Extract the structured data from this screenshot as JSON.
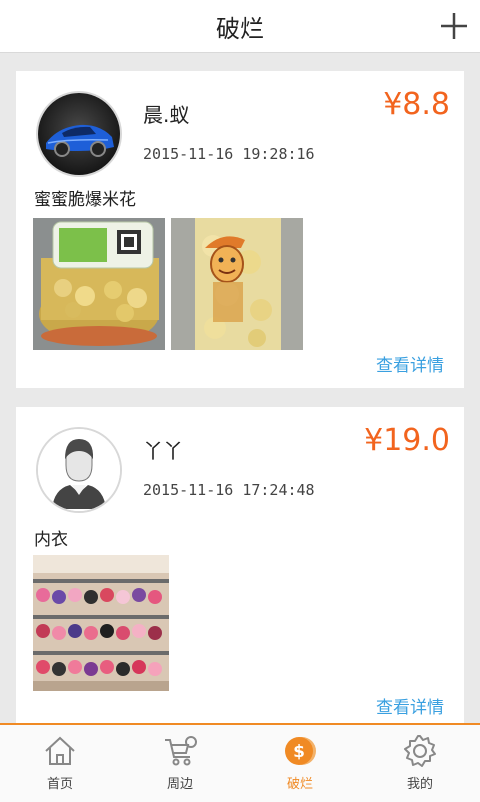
{
  "header": {
    "title": "破烂",
    "add_icon": "plus-icon"
  },
  "posts": [
    {
      "username": "晨.蚁",
      "datetime": "2015-11-16 19:28:16",
      "price": "¥8.8",
      "title": "蜜蜜脆爆米花",
      "detail_link": "查看详情"
    },
    {
      "username": "丫丫",
      "datetime": "2015-11-16 17:24:48",
      "price": "¥19.0",
      "title": "内衣",
      "detail_link": "查看详情"
    }
  ],
  "tabbar": {
    "items": [
      {
        "label": "首页",
        "icon": "home-icon"
      },
      {
        "label": "周边",
        "icon": "cart-icon"
      },
      {
        "label": "破烂",
        "icon": "coin-icon",
        "active": true
      },
      {
        "label": "我的",
        "icon": "gear-icon"
      }
    ]
  },
  "colors": {
    "accent": "#f08a24",
    "price": "#f2641e",
    "link": "#3aa0e0"
  }
}
